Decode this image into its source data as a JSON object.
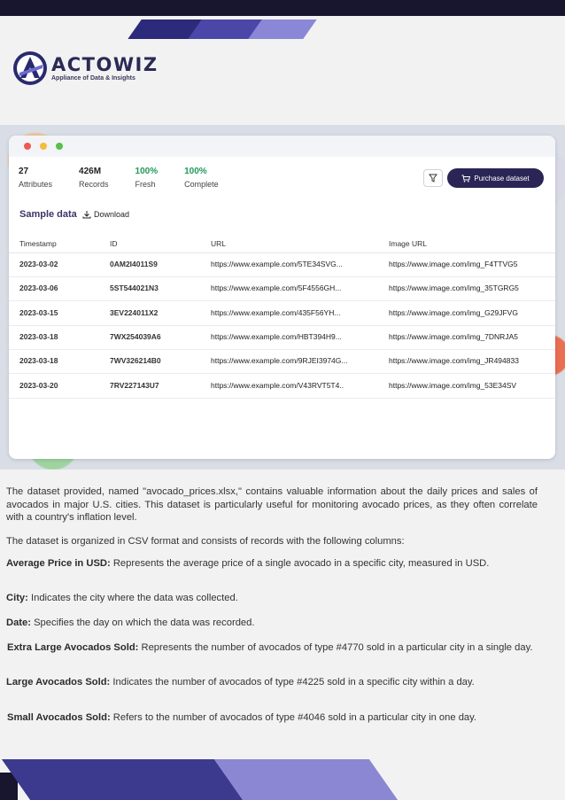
{
  "brand": {
    "name": "ACTOWIZ",
    "tagline": "Appliance of Data & Insights"
  },
  "stats": [
    {
      "value": "27",
      "label": "Attributes",
      "accent": false
    },
    {
      "value": "426M",
      "label": "Records",
      "accent": false
    },
    {
      "value": "100%",
      "label": "Fresh",
      "accent": true
    },
    {
      "value": "100%",
      "label": "Complete",
      "accent": true
    }
  ],
  "toolbar": {
    "filter_icon": "filter-icon",
    "purchase_label": "Purchase dataset"
  },
  "sample": {
    "title": "Sample data",
    "download_label": "Download"
  },
  "table": {
    "headers": [
      "Timestamp",
      "ID",
      "URL",
      "Image URL"
    ],
    "rows": [
      [
        "2023-03-02",
        "0AM2I4011S9",
        "https://www.example.com/5TE34SVG...",
        "https://www.image.com/img_F4TTVG5"
      ],
      [
        "2023-03-06",
        "5ST544021N3",
        "https://www.example.com/5F4556GH...",
        "https://www.image.com/img_35TGRG5"
      ],
      [
        "2023-03-15",
        "3EV224011X2",
        "https://www.example.com/435F56YH...",
        "https://www.image.com/img_G29JFVG"
      ],
      [
        "2023-03-18",
        "7WX254039A6",
        "https://www.example.com/HBT394H9...",
        "https://www.image.com/img_7DNRJA5"
      ],
      [
        "2023-03-18",
        "7WV326214B0",
        "https://www.example.com/9RJEI3974G...",
        "https://www.image.com/img_JR494833"
      ],
      [
        "2023-03-20",
        "7RV227143U7",
        "https://www.example.com/V43RVT5T4..",
        "https://www.image.com/img_53E34SV"
      ]
    ]
  },
  "body": {
    "p1": "The dataset provided, named \"avocado_prices.xlsx,\" contains valuable information about the daily prices and sales of avocados in major U.S. cities. This dataset is particularly useful for monitoring avocado prices, as they often correlate with a country's inflation level.",
    "p2": "The dataset is organized in CSV format and consists of records with the following columns:",
    "fields": [
      {
        "label": "Average Price in USD:",
        "text": " Represents the average price of a single avocado in a specific city, measured in USD."
      },
      {
        "label": "City:",
        "text": " Indicates the city where the data was collected."
      },
      {
        "label": "Date:",
        "text": " Specifies the day on which the data was recorded."
      },
      {
        "label": "Extra Large Avocados Sold:",
        "text": " Represents the number of avocados of type #4770 sold in a particular city in a single day."
      },
      {
        "label": "Large Avocados Sold:",
        "text": " Indicates the number of avocados of type #4225 sold in a specific city within a day."
      },
      {
        "label": "Small Avocados Sold:",
        "text": " Refers to the number of avocados of type #4046 sold in a particular city in one day."
      }
    ]
  },
  "colors": {
    "brand_dark": "#17162e",
    "brand_purple": "#2b2556",
    "fresh_green": "#1f9a5a"
  }
}
